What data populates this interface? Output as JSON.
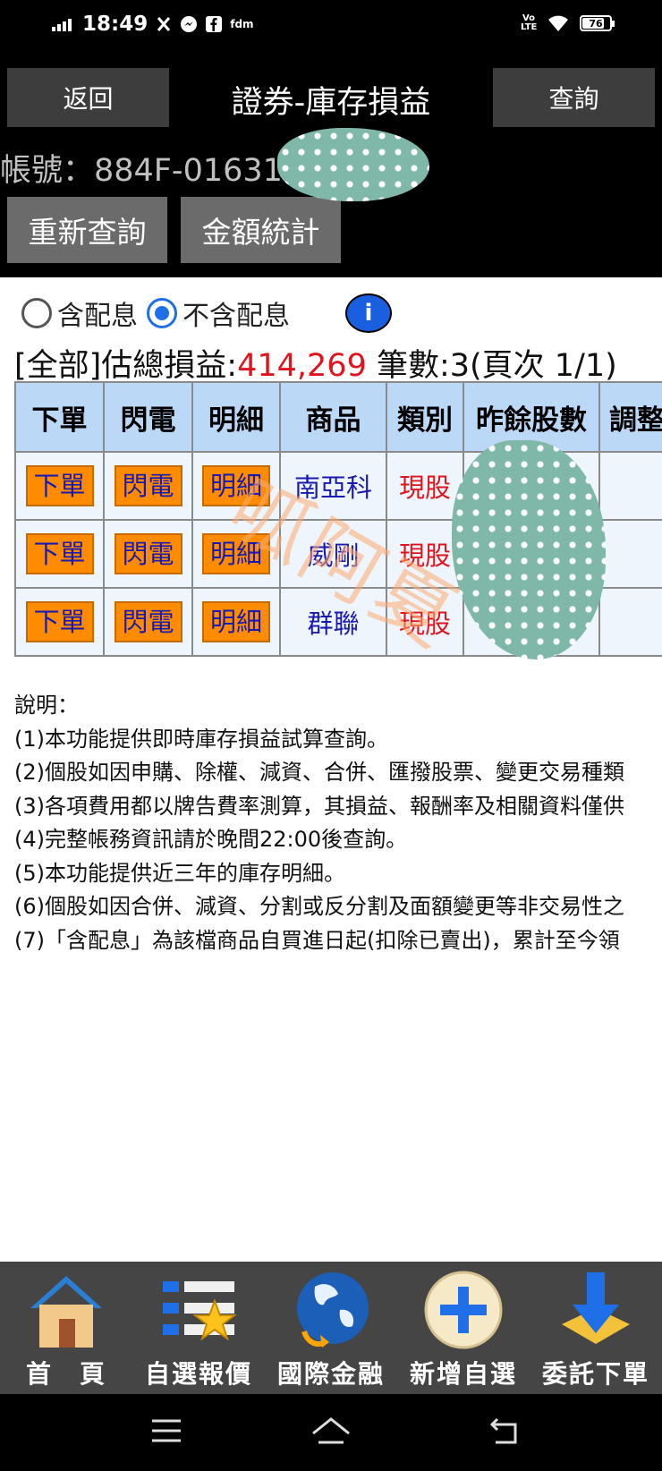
{
  "status_bar": {
    "time": "18:49",
    "carrier_text": "fdm",
    "network": "Vo LTE",
    "battery": "76",
    "icons": [
      "signal-icon",
      "x-icon",
      "messenger-icon",
      "facebook-icon",
      "wifi-icon",
      "battery-icon"
    ]
  },
  "header": {
    "back_label": "返回",
    "title": "證券-庫存損益",
    "query_label": "查詢",
    "account": "帳號：884F-01631",
    "requery_label": "重新查詢",
    "stats_label": "金額統計"
  },
  "options": {
    "with_dividend": "含配息",
    "without_dividend": "不含配息",
    "selected": "不含配息",
    "info_label": "i"
  },
  "summary": {
    "prefix": "[全部]估總損益:",
    "total": "414,269",
    "suffix": " 筆數:3(頁次 1/1)"
  },
  "table": {
    "headers": [
      "下單",
      "閃電",
      "明細",
      "商品",
      "類別",
      "昨餘股數",
      "調整"
    ],
    "rows": [
      {
        "order": "下單",
        "flash": "閃電",
        "detail": "明細",
        "product": "南亞科",
        "kind": "現股",
        "qty": "",
        "adj": "("
      },
      {
        "order": "下單",
        "flash": "閃電",
        "detail": "明細",
        "product": "威剛",
        "kind": "現股",
        "qty": "",
        "adj": "("
      },
      {
        "order": "下單",
        "flash": "閃電",
        "detail": "明細",
        "product": "群聯",
        "kind": "現股",
        "qty": "",
        "adj": "("
      }
    ]
  },
  "watermark": "呱阿夏",
  "notes": {
    "title": "說明：",
    "items": [
      "(1)本功能提供即時庫存損益試算查詢。",
      "(2)個股如因申購、除權、減資、合併、匯撥股票、變更交易種類",
      "(3)各項費用都以牌告費率測算，其損益、報酬率及相關資料僅供",
      "(4)完整帳務資訊請於晚間22:00後查詢。",
      "(5)本功能提供近三年的庫存明細。",
      "(6)個股如因合併、減資、分割或反分割及面額變更等非交易性之",
      "(7)「含配息」為該檔商品自買進日起(扣除已賣出)，累計至今領"
    ]
  },
  "bottom_nav": [
    {
      "label": "首　頁",
      "icon": "home-icon"
    },
    {
      "label": "自選報價",
      "icon": "watchlist-icon"
    },
    {
      "label": "國際金融",
      "icon": "globe-icon"
    },
    {
      "label": "新增自選",
      "icon": "add-icon"
    },
    {
      "label": "委託下單",
      "icon": "order-download-icon"
    }
  ],
  "system_nav": [
    "menu-icon",
    "home-icon",
    "back-icon"
  ],
  "colors": {
    "header_bg": "#000000",
    "button_bg": "#3d3d3d",
    "table_header": "#bcd8f7",
    "order_button": "#ff8c00",
    "profit": "#e0141c",
    "bottom_nav": "#454545"
  }
}
